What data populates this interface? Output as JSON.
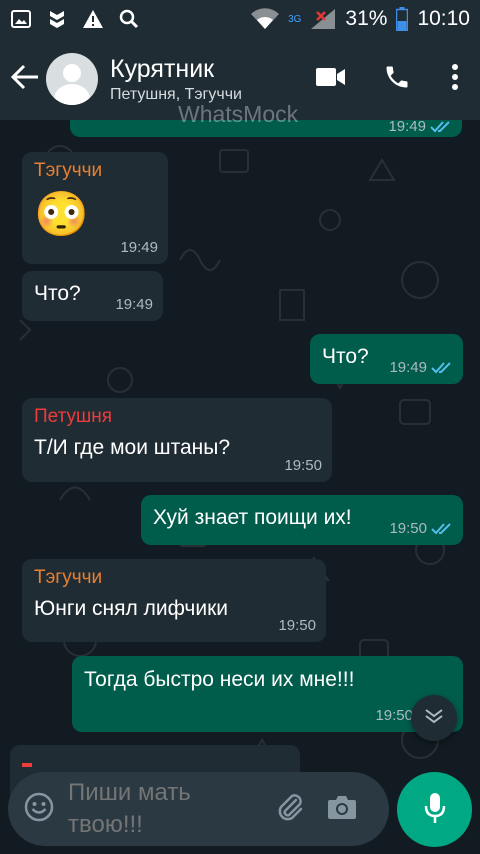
{
  "status_bar": {
    "network": "3G",
    "battery": "31%",
    "time": "10:10",
    "icons": [
      "image-icon",
      "shield-icon",
      "warning-icon",
      "search-icon",
      "wifi-icon",
      "signal-icon",
      "battery-icon"
    ]
  },
  "header": {
    "title": "Курятник",
    "subtitle": "Петушня, Тэгуччи",
    "watermark": "WhatsMock",
    "icons": [
      "back-arrow-icon",
      "avatar",
      "video-call-icon",
      "phone-icon",
      "more-options-icon"
    ]
  },
  "messages": [
    {
      "direction": "out",
      "sender": "",
      "text": "",
      "time": "19:49",
      "ticks": "read"
    },
    {
      "direction": "in",
      "sender": "Тэгуччи",
      "sender_color": "#e97f30",
      "text": "😳",
      "time": "19:49"
    },
    {
      "direction": "in",
      "sender": "",
      "text": "Что?",
      "time": "19:49"
    },
    {
      "direction": "out",
      "sender": "",
      "text": "Что?",
      "time": "19:49",
      "ticks": "read"
    },
    {
      "direction": "in",
      "sender": "Петушня",
      "sender_color": "#ef3b3b",
      "text": "Т/И где мои штаны?",
      "time": "19:50"
    },
    {
      "direction": "out",
      "sender": "",
      "text": "Хуй знает поищи их!",
      "time": "19:50",
      "ticks": "read"
    },
    {
      "direction": "in",
      "sender": "Тэгуччи",
      "sender_color": "#e97f30",
      "text": "Юнги снял лифчики",
      "time": "19:50"
    },
    {
      "direction": "out",
      "sender": "",
      "text": "Тогда быстро неси их мне!!!",
      "time": "19:50",
      "ticks": ""
    },
    {
      "direction": "in",
      "sender": "",
      "text": "",
      "time": ""
    }
  ],
  "composer": {
    "placeholder": "Пиши мать твою!!!",
    "icons": [
      "emoji-icon",
      "attach-icon",
      "camera-icon",
      "mic-icon",
      "chevron-down-icon"
    ]
  },
  "colors": {
    "header_bg": "#1f2c34",
    "chat_bg": "#111b21",
    "incoming_bubble": "#202c33",
    "outgoing_bubble": "#005c4b",
    "accent": "#00a884",
    "read_ticks": "#53bdeb"
  }
}
